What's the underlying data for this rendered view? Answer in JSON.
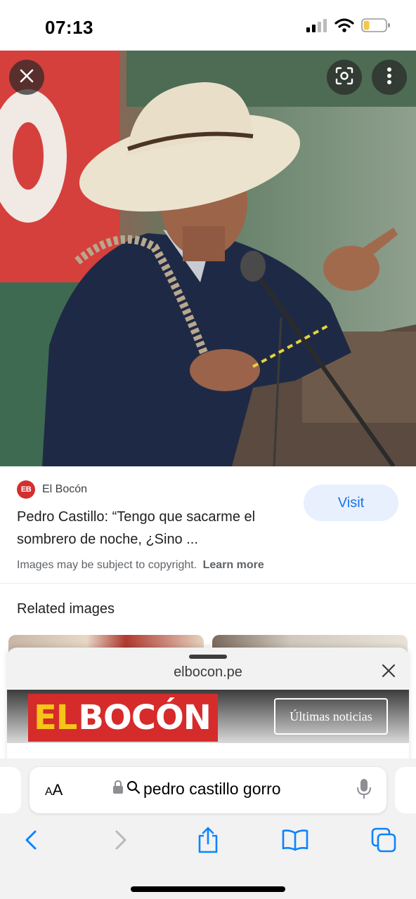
{
  "status_bar": {
    "time": "07:13",
    "icons": [
      "signal-icon",
      "wifi-icon",
      "battery-icon"
    ]
  },
  "image_viewer": {
    "buttons": [
      "close-icon",
      "lens-icon",
      "more-icon"
    ]
  },
  "result": {
    "source_logo": "EB",
    "source_name": "El Bocón",
    "title": "Pedro Castillo: “Tengo que sacarme el sombrero de noche, ¿Sino ...",
    "visit_label": "Visit",
    "copyright_text": "Images may be subject to copyright.",
    "learn_more": "Learn more"
  },
  "related": {
    "title": "Related images"
  },
  "sheet": {
    "domain": "elbocon.pe",
    "logo_el": "EL",
    "logo_bocon": "BOCÓN",
    "ultimas": "Últimas noticias"
  },
  "address_bar": {
    "aa_small": "A",
    "aa_large": "A",
    "query": "pedro castillo gorro"
  },
  "colors": {
    "accent": "#1a73e8",
    "visit_bg": "#e8f0fe",
    "brand_red": "#d62b2b",
    "brand_yellow": "#f5c518"
  }
}
